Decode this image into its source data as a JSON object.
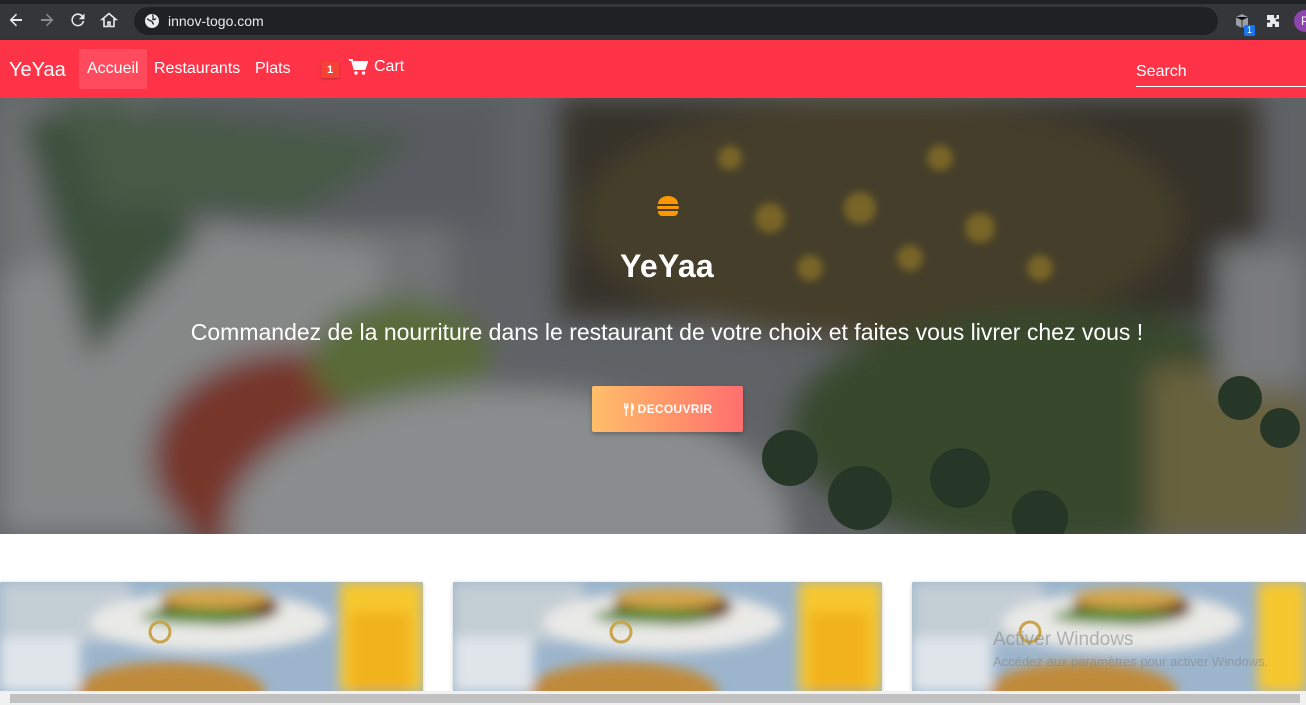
{
  "browser": {
    "url": "innov-togo.com",
    "extension_badge": "1",
    "profile_initial": "P"
  },
  "navbar": {
    "brand": "YeYaa",
    "links": [
      "Accueil",
      "Restaurants",
      "Plats"
    ],
    "active_link": "Accueil",
    "cart_count": "1",
    "cart_label": "Cart",
    "search_placeholder": "Search"
  },
  "hero": {
    "title": "YeYaa",
    "tagline": "Commandez de la nourriture dans le restaurant de votre choix et faites vous livrer chez vous !",
    "button_label": "DECOUVRIR"
  },
  "watermark": {
    "line1": "Activer Windows",
    "line2": "Accédez aux paramètres pour activer Windows."
  },
  "colors": {
    "brand_red": "#ff3347",
    "button_gradient_start": "#ffbe6a",
    "button_gradient_end": "#ff6f6f",
    "icon_orange": "#ff9800"
  },
  "icons": [
    "back-arrow-icon",
    "forward-arrow-icon",
    "reload-icon",
    "home-icon",
    "globe-icon",
    "extension-cube-icon",
    "puzzle-icon",
    "cart-icon",
    "burger-icon",
    "utensils-icon"
  ]
}
